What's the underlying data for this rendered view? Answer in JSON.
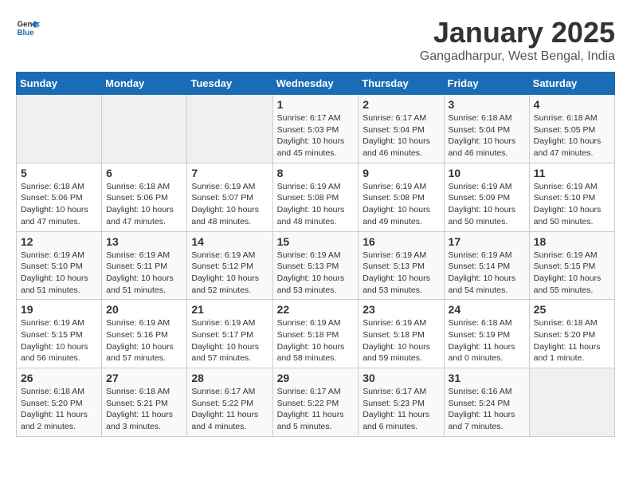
{
  "header": {
    "logo_line1": "General",
    "logo_line2": "Blue",
    "title": "January 2025",
    "subtitle": "Gangadharpur, West Bengal, India"
  },
  "weekdays": [
    "Sunday",
    "Monday",
    "Tuesday",
    "Wednesday",
    "Thursday",
    "Friday",
    "Saturday"
  ],
  "weeks": [
    [
      {
        "day": "",
        "info": ""
      },
      {
        "day": "",
        "info": ""
      },
      {
        "day": "",
        "info": ""
      },
      {
        "day": "1",
        "info": "Sunrise: 6:17 AM\nSunset: 5:03 PM\nDaylight: 10 hours\nand 45 minutes."
      },
      {
        "day": "2",
        "info": "Sunrise: 6:17 AM\nSunset: 5:04 PM\nDaylight: 10 hours\nand 46 minutes."
      },
      {
        "day": "3",
        "info": "Sunrise: 6:18 AM\nSunset: 5:04 PM\nDaylight: 10 hours\nand 46 minutes."
      },
      {
        "day": "4",
        "info": "Sunrise: 6:18 AM\nSunset: 5:05 PM\nDaylight: 10 hours\nand 47 minutes."
      }
    ],
    [
      {
        "day": "5",
        "info": "Sunrise: 6:18 AM\nSunset: 5:06 PM\nDaylight: 10 hours\nand 47 minutes."
      },
      {
        "day": "6",
        "info": "Sunrise: 6:18 AM\nSunset: 5:06 PM\nDaylight: 10 hours\nand 47 minutes."
      },
      {
        "day": "7",
        "info": "Sunrise: 6:19 AM\nSunset: 5:07 PM\nDaylight: 10 hours\nand 48 minutes."
      },
      {
        "day": "8",
        "info": "Sunrise: 6:19 AM\nSunset: 5:08 PM\nDaylight: 10 hours\nand 48 minutes."
      },
      {
        "day": "9",
        "info": "Sunrise: 6:19 AM\nSunset: 5:08 PM\nDaylight: 10 hours\nand 49 minutes."
      },
      {
        "day": "10",
        "info": "Sunrise: 6:19 AM\nSunset: 5:09 PM\nDaylight: 10 hours\nand 50 minutes."
      },
      {
        "day": "11",
        "info": "Sunrise: 6:19 AM\nSunset: 5:10 PM\nDaylight: 10 hours\nand 50 minutes."
      }
    ],
    [
      {
        "day": "12",
        "info": "Sunrise: 6:19 AM\nSunset: 5:10 PM\nDaylight: 10 hours\nand 51 minutes."
      },
      {
        "day": "13",
        "info": "Sunrise: 6:19 AM\nSunset: 5:11 PM\nDaylight: 10 hours\nand 51 minutes."
      },
      {
        "day": "14",
        "info": "Sunrise: 6:19 AM\nSunset: 5:12 PM\nDaylight: 10 hours\nand 52 minutes."
      },
      {
        "day": "15",
        "info": "Sunrise: 6:19 AM\nSunset: 5:13 PM\nDaylight: 10 hours\nand 53 minutes."
      },
      {
        "day": "16",
        "info": "Sunrise: 6:19 AM\nSunset: 5:13 PM\nDaylight: 10 hours\nand 53 minutes."
      },
      {
        "day": "17",
        "info": "Sunrise: 6:19 AM\nSunset: 5:14 PM\nDaylight: 10 hours\nand 54 minutes."
      },
      {
        "day": "18",
        "info": "Sunrise: 6:19 AM\nSunset: 5:15 PM\nDaylight: 10 hours\nand 55 minutes."
      }
    ],
    [
      {
        "day": "19",
        "info": "Sunrise: 6:19 AM\nSunset: 5:15 PM\nDaylight: 10 hours\nand 56 minutes."
      },
      {
        "day": "20",
        "info": "Sunrise: 6:19 AM\nSunset: 5:16 PM\nDaylight: 10 hours\nand 57 minutes."
      },
      {
        "day": "21",
        "info": "Sunrise: 6:19 AM\nSunset: 5:17 PM\nDaylight: 10 hours\nand 57 minutes."
      },
      {
        "day": "22",
        "info": "Sunrise: 6:19 AM\nSunset: 5:18 PM\nDaylight: 10 hours\nand 58 minutes."
      },
      {
        "day": "23",
        "info": "Sunrise: 6:19 AM\nSunset: 5:18 PM\nDaylight: 10 hours\nand 59 minutes."
      },
      {
        "day": "24",
        "info": "Sunrise: 6:18 AM\nSunset: 5:19 PM\nDaylight: 11 hours\nand 0 minutes."
      },
      {
        "day": "25",
        "info": "Sunrise: 6:18 AM\nSunset: 5:20 PM\nDaylight: 11 hours\nand 1 minute."
      }
    ],
    [
      {
        "day": "26",
        "info": "Sunrise: 6:18 AM\nSunset: 5:20 PM\nDaylight: 11 hours\nand 2 minutes."
      },
      {
        "day": "27",
        "info": "Sunrise: 6:18 AM\nSunset: 5:21 PM\nDaylight: 11 hours\nand 3 minutes."
      },
      {
        "day": "28",
        "info": "Sunrise: 6:17 AM\nSunset: 5:22 PM\nDaylight: 11 hours\nand 4 minutes."
      },
      {
        "day": "29",
        "info": "Sunrise: 6:17 AM\nSunset: 5:22 PM\nDaylight: 11 hours\nand 5 minutes."
      },
      {
        "day": "30",
        "info": "Sunrise: 6:17 AM\nSunset: 5:23 PM\nDaylight: 11 hours\nand 6 minutes."
      },
      {
        "day": "31",
        "info": "Sunrise: 6:16 AM\nSunset: 5:24 PM\nDaylight: 11 hours\nand 7 minutes."
      },
      {
        "day": "",
        "info": ""
      }
    ]
  ]
}
